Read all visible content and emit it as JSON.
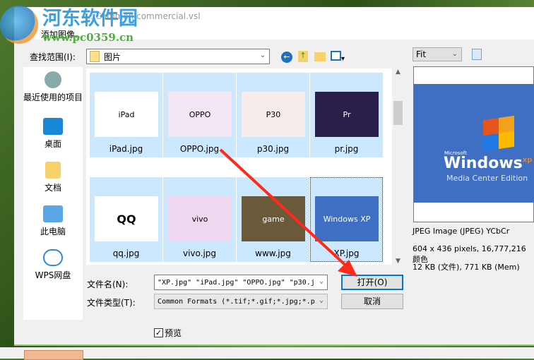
{
  "watermark": {
    "site_name": "河东软件园",
    "url": "www.pc0359.cn"
  },
  "background_title": "... Common commercial.vsl",
  "dialog": {
    "title": "添加图像...",
    "look_in_label": "查找范围(I):",
    "look_in_value": "图片",
    "sidebar": [
      {
        "label": "最近使用的项目",
        "icon": "recent-icon"
      },
      {
        "label": "桌面",
        "icon": "desktop-icon"
      },
      {
        "label": "文档",
        "icon": "documents-icon"
      },
      {
        "label": "此电脑",
        "icon": "computer-icon"
      },
      {
        "label": "WPS网盘",
        "icon": "cloud-icon"
      }
    ],
    "files": [
      {
        "name": "iPad.jpg",
        "thumb": "iPad"
      },
      {
        "name": "OPPO.jpg",
        "thumb": "OPPO"
      },
      {
        "name": "p30.jpg",
        "thumb": "P30"
      },
      {
        "name": "pr.jpg",
        "thumb": "Pr"
      },
      {
        "name": "qq.jpg",
        "thumb": "QQ"
      },
      {
        "name": "vivo.jpg",
        "thumb": "vivo"
      },
      {
        "name": "www.jpg",
        "thumb": "game"
      },
      {
        "name": "XP.jpg",
        "thumb": "Windows XP"
      }
    ],
    "filename_label": "文件名(N):",
    "filename_value": "\"XP.jpg\" \"iPad.jpg\" \"OPPO.jpg\" \"p30.j",
    "filetype_label": "文件类型(T):",
    "filetype_value": "Common Formats (*.tif;*.gif;*.jpg;*.p",
    "open_button": "打开(O)",
    "cancel_button": "取消",
    "preview_checkbox": "预览",
    "preview_checked": true,
    "zoom_value": "Fit",
    "preview_image": {
      "brand": "Microsoft",
      "product": "Windows",
      "sup": "xp",
      "edition": "Media Center Edition"
    },
    "info": [
      "JPEG Image (JPEG) YCbCr",
      "604 x 436 pixels, 16,777,216 颜色",
      "12 KB (文件), 771 KB (Mem)"
    ]
  },
  "colors": {
    "selection": "#cce8ff",
    "accent": "#0078d7",
    "arrow": "#ff2a1a"
  }
}
